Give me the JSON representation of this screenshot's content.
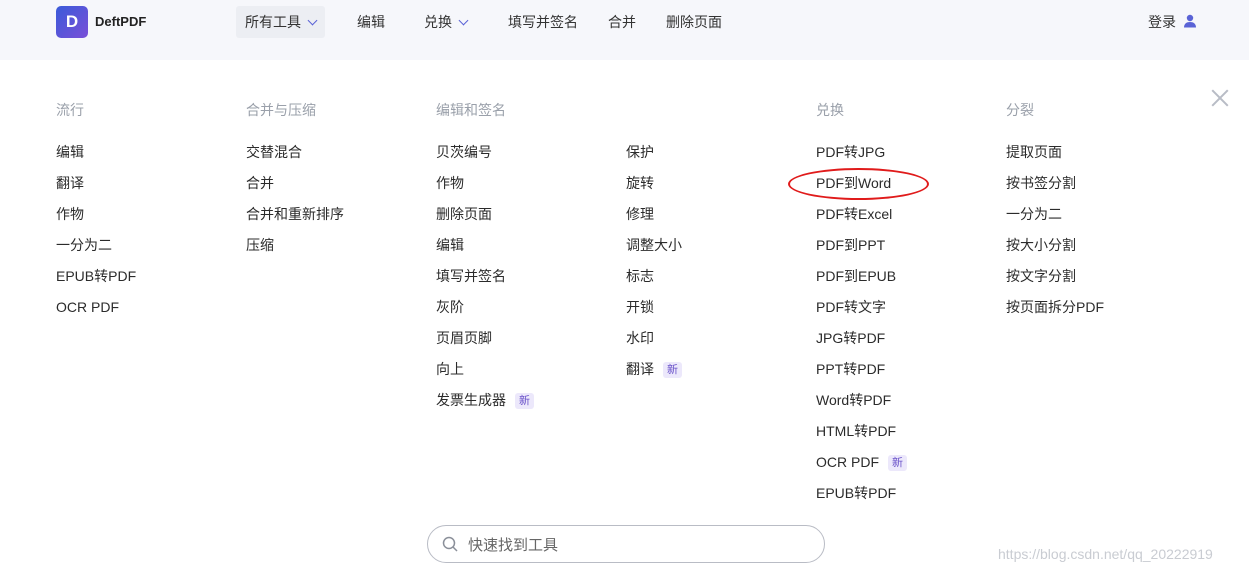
{
  "header": {
    "logo_letter": "D",
    "brand": "DeftPDF",
    "nav": [
      {
        "label": "所有工具",
        "has_dropdown": true,
        "active": true
      },
      {
        "label": "编辑",
        "has_dropdown": false
      },
      {
        "label": "兑换",
        "has_dropdown": true
      },
      {
        "label": "填写并签名",
        "has_dropdown": false
      },
      {
        "label": "合并",
        "has_dropdown": false
      },
      {
        "label": "删除页面",
        "has_dropdown": false
      }
    ],
    "login": "登录"
  },
  "menu": {
    "columns": [
      {
        "title": "流行",
        "items": [
          {
            "label": "编辑"
          },
          {
            "label": "翻译"
          },
          {
            "label": "作物"
          },
          {
            "label": "一分为二"
          },
          {
            "label": "EPUB转PDF"
          },
          {
            "label": "OCR PDF"
          }
        ]
      },
      {
        "title": "合并与压缩",
        "items": [
          {
            "label": "交替混合"
          },
          {
            "label": "合并"
          },
          {
            "label": "合并和重新排序"
          },
          {
            "label": "压缩"
          }
        ]
      },
      {
        "title": "编辑和签名",
        "items": [
          {
            "label": "贝茨编号"
          },
          {
            "label": "作物"
          },
          {
            "label": "删除页面"
          },
          {
            "label": "编辑"
          },
          {
            "label": "填写并签名"
          },
          {
            "label": "灰阶"
          },
          {
            "label": "页眉页脚"
          },
          {
            "label": "向上"
          },
          {
            "label": "发票生成器",
            "badge": "新"
          }
        ]
      },
      {
        "title": "",
        "items": [
          {
            "label": "保护"
          },
          {
            "label": "旋转"
          },
          {
            "label": "修理"
          },
          {
            "label": "调整大小"
          },
          {
            "label": "标志"
          },
          {
            "label": "开锁"
          },
          {
            "label": "水印"
          },
          {
            "label": "翻译",
            "badge": "新"
          }
        ]
      },
      {
        "title": "兑换",
        "items": [
          {
            "label": "PDF转JPG"
          },
          {
            "label": "PDF到Word"
          },
          {
            "label": "PDF转Excel"
          },
          {
            "label": "PDF到PPT"
          },
          {
            "label": "PDF到EPUB"
          },
          {
            "label": "PDF转文字"
          },
          {
            "label": "JPG转PDF"
          },
          {
            "label": "PPT转PDF"
          },
          {
            "label": "Word转PDF"
          },
          {
            "label": "HTML转PDF"
          },
          {
            "label": "OCR PDF",
            "badge": "新"
          },
          {
            "label": "EPUB转PDF"
          }
        ]
      },
      {
        "title": "分裂",
        "items": [
          {
            "label": "提取页面"
          },
          {
            "label": "按书签分割"
          },
          {
            "label": "一分为二"
          },
          {
            "label": "按大小分割"
          },
          {
            "label": "按文字分割"
          },
          {
            "label": "按页面拆分PDF"
          }
        ]
      }
    ]
  },
  "search": {
    "placeholder": "快速找到工具",
    "value": ""
  },
  "watermark": "https://blog.csdn.net/qq_20222919",
  "icons": {
    "user": "user-icon",
    "search": "search-icon",
    "close": "close-icon",
    "dropdown": "chevron-down-icon"
  },
  "colors": {
    "accent": "#5a63d6",
    "badge_bg": "#ece8fb",
    "annotation_ring": "#e01b1b"
  }
}
